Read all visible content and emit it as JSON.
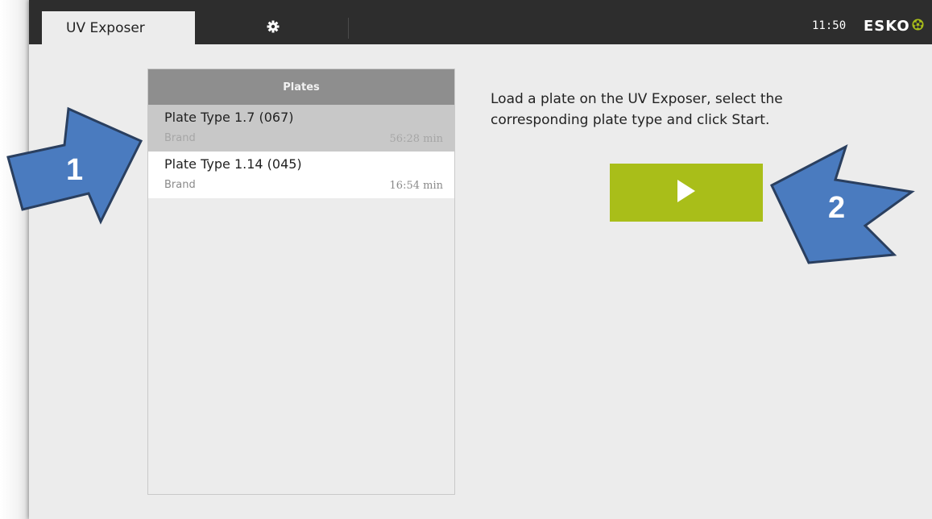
{
  "header": {
    "active_tab_label": "UV Exposer",
    "settings_icon": "gear-icon",
    "clock": "11:50",
    "brand": "ESKO",
    "brand_mark_icon": "esko-flower-icon",
    "brand_mark_color": "#a9be19"
  },
  "plates": {
    "header": "Plates",
    "items": [
      {
        "name": "Plate Type 1.7 (067)",
        "brand": "Brand",
        "time": "56:28 min",
        "selected": true
      },
      {
        "name": "Plate Type 1.14 (045)",
        "brand": "Brand",
        "time": "16:54 min",
        "selected": false
      }
    ]
  },
  "instructions": {
    "text": "Load a plate on the UV Exposer, select the corresponding plate type and click Start."
  },
  "start_button": {
    "icon": "play-icon",
    "color": "#a9be19"
  },
  "callouts": [
    {
      "number": "1",
      "color": "#4a7bbf"
    },
    {
      "number": "2",
      "color": "#4a7bbf"
    }
  ]
}
